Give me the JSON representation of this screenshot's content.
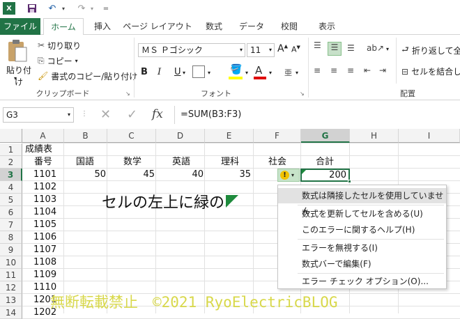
{
  "app": {
    "quick_access_more": "="
  },
  "tabs": [
    "ファイル",
    "ホーム",
    "挿入",
    "ページ レイアウト",
    "数式",
    "データ",
    "校閲",
    "表示"
  ],
  "ribbon": {
    "paste_label": "貼り付け",
    "cut_label": "切り取り",
    "copy_label": "コピー",
    "format_painter_label": "書式のコピー/貼り付け",
    "clipboard_group": "クリップボード",
    "font_name": "ＭＳ Ｐゴシック",
    "font_size": "11",
    "font_group": "フォント",
    "wrap_text_label": "折り返して全",
    "merge_label": "セルを結合し",
    "alignment_group": "配置",
    "bold": "B",
    "italic": "I",
    "underline": "U",
    "font_color_glyph": "A"
  },
  "formula_bar": {
    "name_box": "G3",
    "fx": "fx",
    "formula": "=SUM(B3:F3)"
  },
  "columns": [
    "A",
    "B",
    "C",
    "D",
    "E",
    "F",
    "G",
    "H",
    "I"
  ],
  "rows": [
    "1",
    "2",
    "3",
    "4",
    "5",
    "6",
    "7",
    "8",
    "9",
    "10",
    "11",
    "12",
    "13",
    "14"
  ],
  "sheet": {
    "a1": "成績表",
    "headers": [
      "番号",
      "国語",
      "数学",
      "英語",
      "理科",
      "社会",
      "合計"
    ],
    "row3": {
      "id": "1101",
      "b": "50",
      "c": "45",
      "d": "40",
      "e": "35",
      "g": "200"
    },
    "ids": [
      "1102",
      "1103",
      "1104",
      "1105",
      "1106",
      "1107",
      "1108",
      "1109",
      "1110",
      "1201",
      "1202"
    ]
  },
  "annotation": "セルの左上に緑の",
  "error_menu": [
    "数式は隣接したセルを使用していません",
    "数式を更新してセルを含める(U)",
    "このエラーに関するヘルプ(H)",
    "エラーを無視する(I)",
    "数式バーで編集(F)",
    "エラー チェック オプション(O)..."
  ],
  "watermark": "無断転載禁止　©2021 RyoElectricBLOG",
  "colors": {
    "accent": "#217346",
    "selected_col": "#d2d2d2",
    "menu_hover": "#e2e2e2"
  }
}
